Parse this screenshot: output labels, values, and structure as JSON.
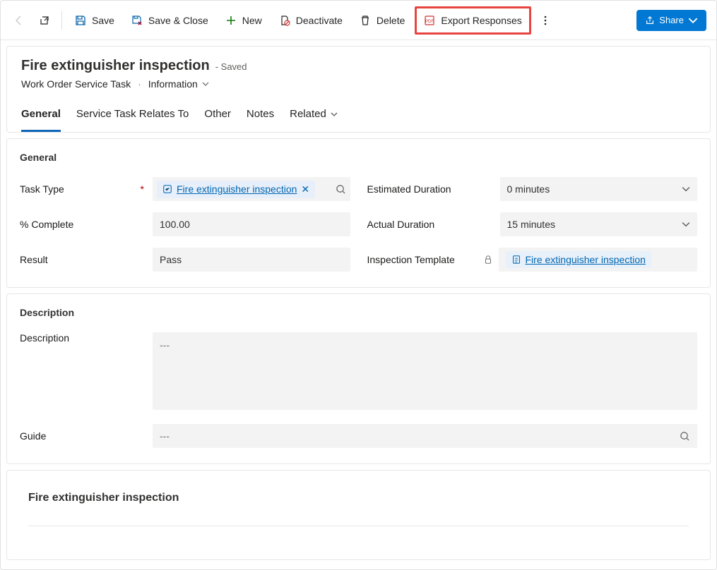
{
  "commands": {
    "save": "Save",
    "saveClose": "Save & Close",
    "new": "New",
    "deactivate": "Deactivate",
    "delete": "Delete",
    "exportResponses": "Export Responses",
    "share": "Share"
  },
  "header": {
    "title": "Fire extinguisher inspection",
    "savedTag": "- Saved",
    "entity": "Work Order Service Task",
    "form": "Information"
  },
  "tabs": {
    "general": "General",
    "relatesTo": "Service Task Relates To",
    "other": "Other",
    "notes": "Notes",
    "related": "Related"
  },
  "section1": {
    "title": "General",
    "taskType": {
      "label": "Task Type",
      "value": "Fire extinguisher inspection"
    },
    "percentComplete": {
      "label": "% Complete",
      "value": "100.00"
    },
    "result": {
      "label": "Result",
      "value": "Pass"
    },
    "estimatedDuration": {
      "label": "Estimated Duration",
      "value": "0 minutes"
    },
    "actualDuration": {
      "label": "Actual Duration",
      "value": "15 minutes"
    },
    "inspectionTemplate": {
      "label": "Inspection Template",
      "value": "Fire extinguisher inspection"
    }
  },
  "section2": {
    "title": "Description",
    "description": {
      "label": "Description",
      "value": "---"
    },
    "guide": {
      "label": "Guide",
      "value": "---"
    }
  },
  "section3": {
    "title": "Fire extinguisher inspection"
  }
}
